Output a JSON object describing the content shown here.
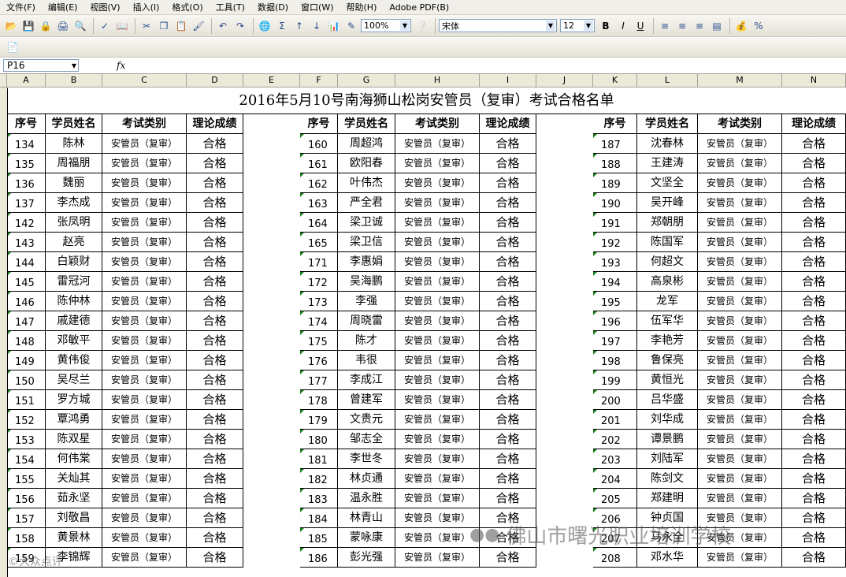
{
  "menu": [
    "文件(F)",
    "编辑(E)",
    "视图(V)",
    "插入(I)",
    "格式(O)",
    "工具(T)",
    "数据(D)",
    "窗口(W)",
    "帮助(H)",
    "Adobe PDF(B)"
  ],
  "toolbar": {
    "zoom": "100%",
    "font": "宋体",
    "font_size": "12"
  },
  "formula_bar": {
    "cell_ref": "P16",
    "fx": "fx"
  },
  "columns": [
    "A",
    "B",
    "C",
    "D",
    "E",
    "F",
    "G",
    "H",
    "I",
    "J",
    "K",
    "L",
    "M",
    "N"
  ],
  "sheet": {
    "title": "2016年5月10号南海狮山松岗安管员（复审）考试合格名单",
    "headers": [
      "序号",
      "学员姓名",
      "考试类别",
      "理论成绩"
    ],
    "exam_type": "安管员（复审）",
    "grade": "合格",
    "blocks": [
      {
        "rows": [
          {
            "seq": "134",
            "name": "陈林"
          },
          {
            "seq": "135",
            "name": "周福朋"
          },
          {
            "seq": "136",
            "name": "魏丽"
          },
          {
            "seq": "137",
            "name": "李杰成"
          },
          {
            "seq": "142",
            "name": "张凤明"
          },
          {
            "seq": "143",
            "name": "赵亮"
          },
          {
            "seq": "144",
            "name": "白颖财"
          },
          {
            "seq": "145",
            "name": "雷冠河"
          },
          {
            "seq": "146",
            "name": "陈仲林"
          },
          {
            "seq": "147",
            "name": "戚建德"
          },
          {
            "seq": "148",
            "name": "邓敏平"
          },
          {
            "seq": "149",
            "name": "黄伟俊"
          },
          {
            "seq": "150",
            "name": "吴尽兰"
          },
          {
            "seq": "151",
            "name": "罗方城"
          },
          {
            "seq": "152",
            "name": "覃鸿勇"
          },
          {
            "seq": "153",
            "name": "陈双星"
          },
          {
            "seq": "154",
            "name": "何伟棠"
          },
          {
            "seq": "155",
            "name": "关灿其"
          },
          {
            "seq": "156",
            "name": "茹永坚"
          },
          {
            "seq": "157",
            "name": "刘敬昌"
          },
          {
            "seq": "158",
            "name": "黄景林"
          },
          {
            "seq": "159",
            "name": "李锦辉"
          }
        ]
      },
      {
        "rows": [
          {
            "seq": "160",
            "name": "周超鸿"
          },
          {
            "seq": "161",
            "name": "欧阳春"
          },
          {
            "seq": "162",
            "name": "叶伟杰"
          },
          {
            "seq": "163",
            "name": "严全君"
          },
          {
            "seq": "164",
            "name": "梁卫诚"
          },
          {
            "seq": "165",
            "name": "梁卫信"
          },
          {
            "seq": "171",
            "name": "李惠娟"
          },
          {
            "seq": "172",
            "name": "吴海鹏"
          },
          {
            "seq": "173",
            "name": "李强"
          },
          {
            "seq": "174",
            "name": "周晓雷"
          },
          {
            "seq": "175",
            "name": "陈才"
          },
          {
            "seq": "176",
            "name": "韦很"
          },
          {
            "seq": "177",
            "name": "李成江"
          },
          {
            "seq": "178",
            "name": "曾建军"
          },
          {
            "seq": "179",
            "name": "文贵元"
          },
          {
            "seq": "180",
            "name": "邹志全"
          },
          {
            "seq": "181",
            "name": "李世冬"
          },
          {
            "seq": "182",
            "name": "林贞通"
          },
          {
            "seq": "183",
            "name": "温永胜"
          },
          {
            "seq": "184",
            "name": "林青山"
          },
          {
            "seq": "185",
            "name": "蒙咏康"
          },
          {
            "seq": "186",
            "name": "彭光强"
          }
        ]
      },
      {
        "rows": [
          {
            "seq": "187",
            "name": "沈春林"
          },
          {
            "seq": "188",
            "name": "王建涛"
          },
          {
            "seq": "189",
            "name": "文坚全"
          },
          {
            "seq": "190",
            "name": "吴开峰"
          },
          {
            "seq": "191",
            "name": "郑朝朋"
          },
          {
            "seq": "192",
            "name": "陈国军"
          },
          {
            "seq": "193",
            "name": "何超文"
          },
          {
            "seq": "194",
            "name": "高泉彬"
          },
          {
            "seq": "195",
            "name": "龙军"
          },
          {
            "seq": "196",
            "name": "伍军华"
          },
          {
            "seq": "197",
            "name": "李艳芳"
          },
          {
            "seq": "198",
            "name": "鲁保亮"
          },
          {
            "seq": "199",
            "name": "黄恒光"
          },
          {
            "seq": "200",
            "name": "吕华盛"
          },
          {
            "seq": "201",
            "name": "刘华成"
          },
          {
            "seq": "202",
            "name": "谭景鹏"
          },
          {
            "seq": "203",
            "name": "刘陆军"
          },
          {
            "seq": "204",
            "name": "陈剑文"
          },
          {
            "seq": "205",
            "name": "郑建明"
          },
          {
            "seq": "206",
            "name": "钟贞国"
          },
          {
            "seq": "207",
            "name": "马永全"
          },
          {
            "seq": "208",
            "name": "邓水华"
          }
        ]
      }
    ]
  },
  "watermark": {
    "text": "佛山市曙光职业培训学校",
    "corner": "©大众点评"
  }
}
